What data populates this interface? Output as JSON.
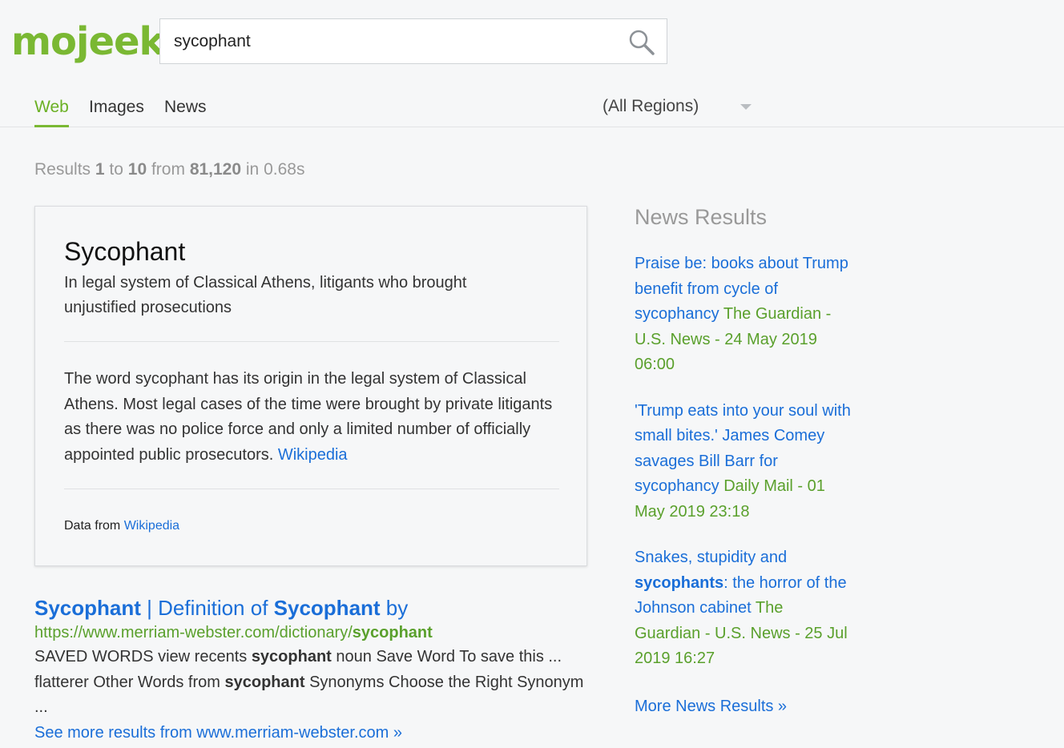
{
  "brand": {
    "logo_text": "mojeek",
    "accent": "#7ab833",
    "link_color": "#1a6ed8",
    "url_color": "#5aa02c"
  },
  "search": {
    "query": "sycophant",
    "icon": "search-icon"
  },
  "tabs": [
    {
      "label": "Web",
      "active": true
    },
    {
      "label": "Images",
      "active": false
    },
    {
      "label": "News",
      "active": false
    }
  ],
  "region": {
    "selected": "(All Regions)"
  },
  "stats": {
    "prefix": "Results",
    "from": "1",
    "to_word": "to",
    "to": "10",
    "from_word": "from",
    "total": "81,120",
    "in_word": "in",
    "time": "0.68s"
  },
  "infobox": {
    "title": "Sycophant",
    "subtitle": "In legal system of Classical Athens, litigants who brought unjustified prosecutions",
    "body": "The word sycophant has its origin in the legal system of Classical Athens. Most legal cases of the time were brought by private litigants as there was no police force and only a limited number of officially appointed public prosecutors.",
    "body_link": "Wikipedia",
    "source_prefix": "Data from",
    "source_link": "Wikipedia"
  },
  "results": [
    {
      "title_parts": [
        "Sycophant",
        " | Definition of ",
        "Sycophant",
        " by"
      ],
      "url_prefix": "https://www.merriam-webster.com/dictionary/",
      "url_bold": "sycophant",
      "snippet_parts": [
        "SAVED WORDS view recents ",
        "sycophant",
        " noun Save Word To save this ... flatterer Other Words from ",
        "sycophant",
        " Synonyms Choose the Right Synonym ..."
      ],
      "more": "See more results from www.merriam-webster.com »"
    }
  ],
  "news": {
    "heading": "News Results",
    "items": [
      {
        "title_pre": "Praise be: books about Trump benefit from cycle of sycophancy",
        "title_bold": "",
        "title_post": "",
        "meta": "The Guardian - U.S. News - 24 May 2019 06:00"
      },
      {
        "title_pre": "'Trump eats into your soul with small bites.' James Comey savages Bill Barr for sycophancy",
        "title_bold": "",
        "title_post": "",
        "meta": "Daily Mail - 01 May 2019 23:18"
      },
      {
        "title_pre": "Snakes, stupidity and ",
        "title_bold": "sycophants",
        "title_post": ": the horror of the Johnson cabinet",
        "meta": "The Guardian - U.S. News - 25 Jul 2019 16:27"
      }
    ],
    "more": "More News Results »"
  }
}
